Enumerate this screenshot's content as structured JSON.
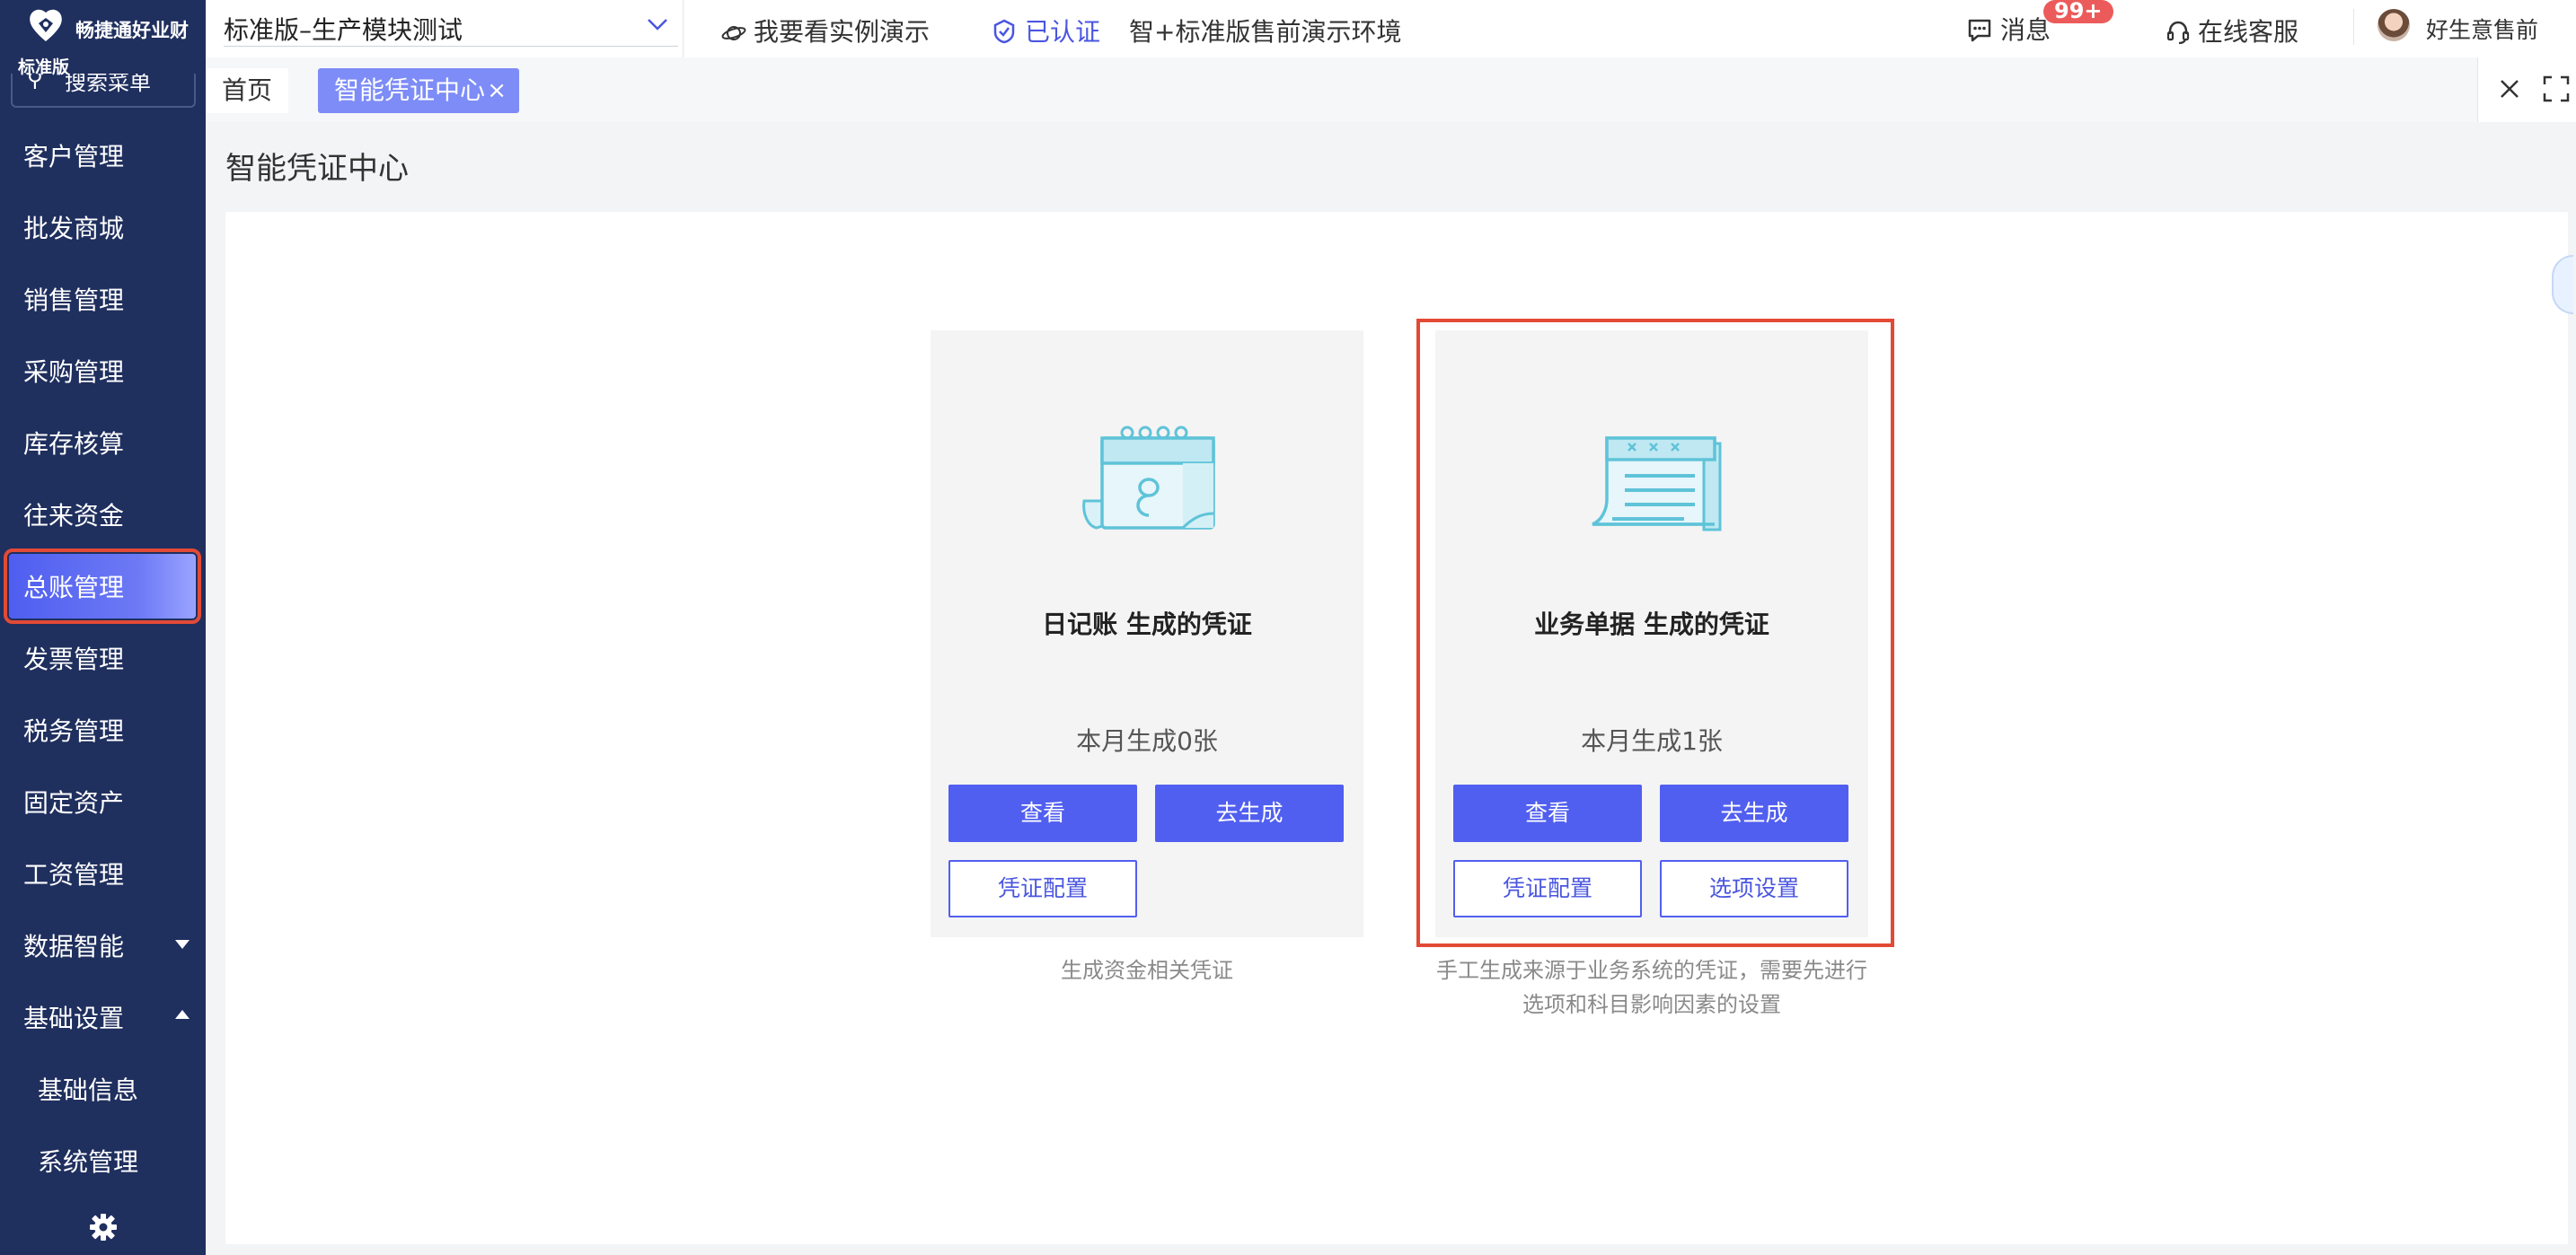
{
  "sidebar": {
    "brand_name": "畅捷通好业财",
    "edition": "标准版",
    "search_placeholder": "搜索菜单",
    "items": [
      {
        "label": "客户管理"
      },
      {
        "label": "批发商城"
      },
      {
        "label": "销售管理"
      },
      {
        "label": "采购管理"
      },
      {
        "label": "库存核算"
      },
      {
        "label": "往来资金"
      },
      {
        "label": "总账管理",
        "active": true
      },
      {
        "label": "发票管理"
      },
      {
        "label": "税务管理"
      },
      {
        "label": "固定资产"
      },
      {
        "label": "工资管理"
      },
      {
        "label": "数据智能",
        "caret": "down"
      },
      {
        "label": "基础设置",
        "caret": "up"
      },
      {
        "label": "基础信息",
        "sub": true
      },
      {
        "label": "系统管理",
        "sub": true
      }
    ],
    "settings_icon": "gear-icon"
  },
  "topbar": {
    "environment": "标准版–生产模块测试",
    "demo_link": "我要看实例演示",
    "certified": "已认证",
    "env_name": "智+标准版售前演示环境",
    "messages_label": "消息",
    "messages_badge": "99+",
    "service_label": "在线客服",
    "user_name": "好生意售前"
  },
  "tabs": {
    "home": "首页",
    "current": "智能凭证中心",
    "close_glyph": "×"
  },
  "page": {
    "title": "智能凭证中心",
    "cards": [
      {
        "title": "日记账 生成的凭证",
        "count": "本月生成0张",
        "buttons": {
          "view": "查看",
          "generate": "去生成",
          "config": "凭证配置"
        },
        "description": [
          "生成资金相关凭证"
        ]
      },
      {
        "title": "业务单据 生成的凭证",
        "count": "本月生成1张",
        "buttons": {
          "view": "查看",
          "generate": "去生成",
          "config": "凭证配置",
          "options": "选项设置"
        },
        "description": [
          "手工生成来源于业务系统的凭证，需要先进行",
          "选项和科目影响因素的设置"
        ]
      }
    ]
  },
  "colors": {
    "sidebar_bg": "#1f2f5e",
    "primary": "#515ff0",
    "active_tab": "#7d8cf7",
    "highlight": "#e24a36",
    "badge": "#ec5b5b",
    "icon_teal": "#5fc3d8"
  }
}
